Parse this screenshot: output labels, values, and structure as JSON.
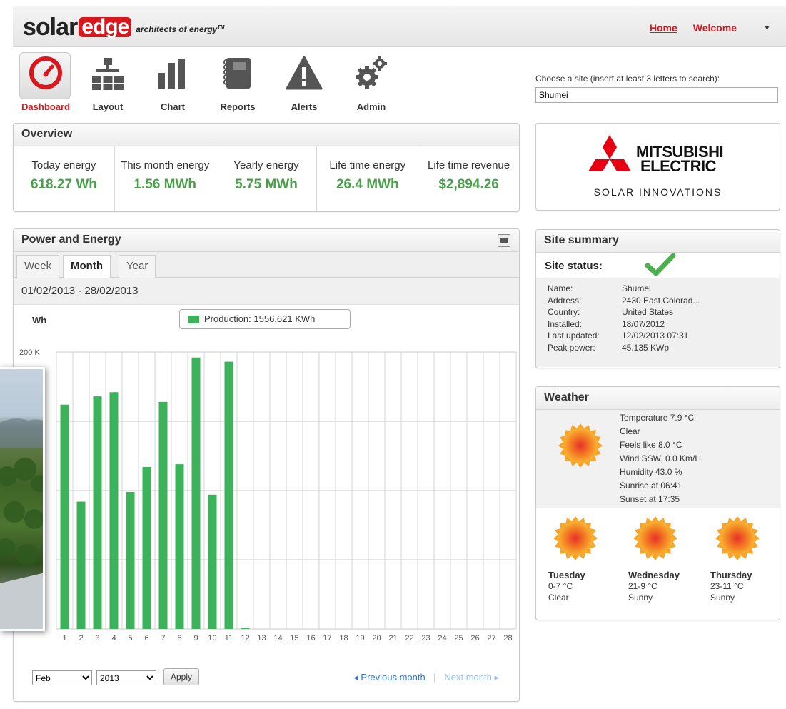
{
  "header": {
    "logo_solar": "solar",
    "logo_edge": "edge",
    "logo_tagline": "architects of energy",
    "logo_tm": "TM",
    "home": "Home",
    "welcome": "Welcome",
    "menu_caret": "▾"
  },
  "toolbar": {
    "items": [
      {
        "label": "Dashboard",
        "icon": "speedometer-icon",
        "active": true
      },
      {
        "label": "Layout",
        "icon": "hierarchy-icon"
      },
      {
        "label": "Chart",
        "icon": "bar-chart-icon"
      },
      {
        "label": "Reports",
        "icon": "notebook-icon"
      },
      {
        "label": "Alerts",
        "icon": "warning-icon"
      },
      {
        "label": "Admin",
        "icon": "gears-icon"
      }
    ]
  },
  "site_chooser": {
    "label": "Choose a site (insert at least 3 letters to search):",
    "value": "Shumei"
  },
  "overview": {
    "title": "Overview",
    "cells": [
      {
        "label": "Today energy",
        "value": "618.27 Wh"
      },
      {
        "label": "This month energy",
        "value": "1.56 MWh"
      },
      {
        "label": "Yearly energy",
        "value": "5.75 MWh"
      },
      {
        "label": "Life time energy",
        "value": "26.4 MWh"
      },
      {
        "label": "Life time revenue",
        "value": "$2,894.26"
      }
    ],
    "value_color": "#4aa04a"
  },
  "brand": {
    "line1": "MITSUBISHI",
    "line2": "ELECTRIC",
    "line3": "SOLAR INNOVATIONS",
    "mark_color": "#e60012"
  },
  "power_energy": {
    "title": "Power and Energy",
    "tabs": [
      "Week",
      "Month",
      "Year"
    ],
    "active_tab": "Month",
    "date_range": "01/02/2013 - 28/02/2013",
    "unit": "Wh",
    "legend": "Production: 1556.621 KWh",
    "controls": {
      "month": "Feb",
      "year": "2013",
      "apply": "Apply",
      "prev": "◂ Previous month",
      "separator": "|",
      "next": "Next month ▸"
    }
  },
  "chart_data": {
    "type": "bar",
    "categories": [
      "1",
      "2",
      "3",
      "4",
      "5",
      "6",
      "7",
      "8",
      "9",
      "10",
      "11",
      "12",
      "13",
      "14",
      "15",
      "16",
      "17",
      "18",
      "19",
      "20",
      "21",
      "22",
      "23",
      "24",
      "25",
      "26",
      "27",
      "28"
    ],
    "values": [
      162000,
      92000,
      168000,
      171000,
      99000,
      117000,
      164000,
      119000,
      196000,
      97000,
      193000,
      1000,
      0,
      0,
      0,
      0,
      0,
      0,
      0,
      0,
      0,
      0,
      0,
      0,
      0,
      0,
      0,
      0
    ],
    "ylim": [
      0,
      200000
    ],
    "y_ticks": [
      {
        "value": 200000,
        "label": "200 K"
      }
    ],
    "ylabel": "Wh",
    "grid": true,
    "series_color": "#3cb35a"
  },
  "site_summary": {
    "title": "Site summary",
    "status_label": "Site status:",
    "status_icon": "checkmark-icon",
    "rows": [
      {
        "k": "Name:",
        "v": "Shumei"
      },
      {
        "k": "Address:",
        "v": "2430 East Colorad..."
      },
      {
        "k": "Country:",
        "v": "United States"
      },
      {
        "k": "Installed:",
        "v": "18/07/2012"
      },
      {
        "k": "Last updated:",
        "v": "12/02/2013 07:31"
      },
      {
        "k": "Peak power:",
        "v": "45.135 KWp"
      }
    ]
  },
  "weather": {
    "title": "Weather",
    "current": [
      "Temperature 7.9 °C",
      "Clear",
      "Feels like 8.0 °C",
      "Wind SSW, 0.0 Km/H",
      "Humidity 43.0 %",
      "Sunrise at 06:41",
      "Sunset at 17:35"
    ],
    "forecast": [
      {
        "day": "Tuesday",
        "temp": "0-7 °C",
        "cond": "Clear"
      },
      {
        "day": "Wednesday",
        "temp": "21-9 °C",
        "cond": "Sunny"
      },
      {
        "day": "Thursday",
        "temp": "23-11 °C",
        "cond": "Sunny"
      }
    ]
  }
}
